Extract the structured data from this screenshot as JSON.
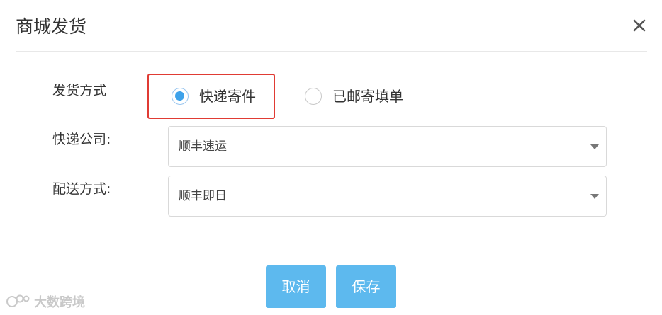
{
  "dialog": {
    "title": "商城发货",
    "close_icon": "close-icon"
  },
  "form": {
    "ship_method": {
      "label": "发货方式",
      "options": [
        {
          "label": "快递寄件",
          "selected": true
        },
        {
          "label": "已邮寄填单",
          "selected": false
        }
      ]
    },
    "courier": {
      "label": "快递公司:",
      "value": "顺丰速运"
    },
    "delivery": {
      "label": "配送方式:",
      "value": "顺丰即日"
    }
  },
  "buttons": {
    "cancel": "取消",
    "save": "保存"
  },
  "watermark": {
    "text": "大数跨境",
    "icon": "logo-icon"
  },
  "colors": {
    "primary_button": "#5db9ee",
    "radio_checked": "#3ea2ea",
    "highlight_border": "#e03b34"
  }
}
